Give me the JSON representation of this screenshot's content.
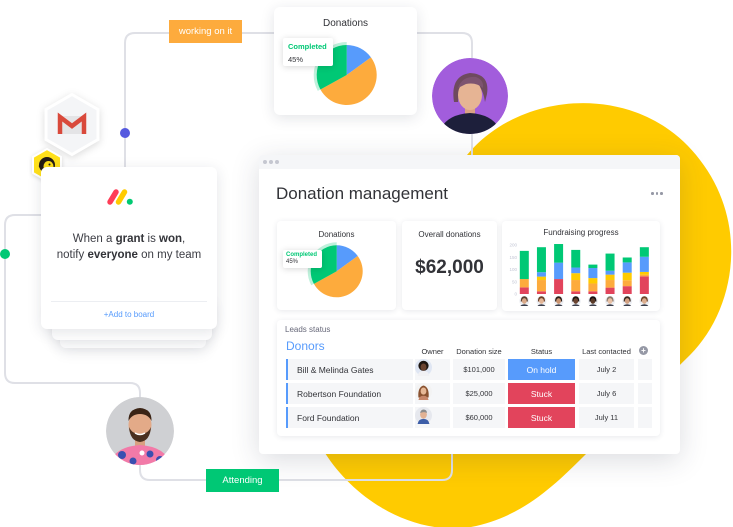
{
  "connectors": {
    "working_label": "working on it",
    "attending_label": "Attending"
  },
  "colors": {
    "brand_yellow": "#ffcb00",
    "green": "#00c875",
    "blue": "#579bfc",
    "orange": "#fdab3d",
    "red": "#e2445c",
    "purple": "#a25ddc",
    "connector_dot_blue": "#5559df"
  },
  "integrations": {
    "gmail": "gmail-icon",
    "mailchimp": "mailchimp-icon"
  },
  "automation": {
    "sentence": {
      "t1": "When a ",
      "b1": "grant",
      "t2": " is ",
      "b2": "won",
      "t3": ",",
      "t4": "notify ",
      "b3": "everyone",
      "t5": " on my team"
    },
    "add_label": "+Add to board"
  },
  "board": {
    "title": "Donation management",
    "widgets": {
      "overall": {
        "title": "Overall donations",
        "value": "$62,000"
      }
    },
    "leads": {
      "title": "Leads status",
      "group": "Donors",
      "columns": {
        "owner": "Owner",
        "donation": "Donation size",
        "status": "Status",
        "last": "Last contacted"
      },
      "rows": [
        {
          "name": "Bill & Melinda Gates",
          "donation": "$101,000",
          "status": "On hold",
          "status_color": "#579bfc",
          "last_contacted": "July 2"
        },
        {
          "name": "Robertson Foundation",
          "donation": "$25,000",
          "status": "Stuck",
          "status_color": "#e2445c",
          "last_contacted": "July 6"
        },
        {
          "name": "Ford Foundation",
          "donation": "$60,000",
          "status": "Stuck",
          "status_color": "#e2445c",
          "last_contacted": "July 11"
        }
      ]
    }
  },
  "chart_data": [
    {
      "type": "pie",
      "title": "Donations",
      "tooltip": {
        "label": "Completed",
        "value": "45%"
      },
      "slices": [
        {
          "label": "blue",
          "value": 15,
          "color": "#579bfc"
        },
        {
          "label": "orange",
          "value": 52,
          "color": "#fdab3d"
        },
        {
          "label": "Completed",
          "value": 33,
          "color": "#00c875",
          "highlight": true
        }
      ]
    },
    {
      "type": "pie",
      "title": "Donations",
      "tooltip": {
        "label": "Completed",
        "value": "45%"
      },
      "slices": [
        {
          "label": "blue",
          "value": 15,
          "color": "#579bfc"
        },
        {
          "label": "orange",
          "value": 52,
          "color": "#fdab3d"
        },
        {
          "label": "Completed",
          "value": 33,
          "color": "#00c875",
          "highlight": true
        }
      ]
    },
    {
      "type": "bar",
      "stacked": true,
      "title": "Fundraising progress",
      "xlabel": "",
      "ylabel": "",
      "y_ticks": [
        0,
        50,
        100,
        150,
        200
      ],
      "ylim": [
        0,
        200
      ],
      "grid": false,
      "legend": "none",
      "categories": [
        {
          "avatar": "owner-avatar",
          "skin": "#d9a988",
          "hair": "#5a4030"
        },
        {
          "avatar": "owner-avatar",
          "skin": "#e2b596",
          "hair": "#6b3f26"
        },
        {
          "avatar": "owner-avatar",
          "skin": "#c99370",
          "hair": "#2a1d15"
        },
        {
          "avatar": "owner-avatar",
          "skin": "#6b4430",
          "hair": "#1c1410"
        },
        {
          "avatar": "owner-avatar",
          "skin": "#5a3a28",
          "hair": "#161010"
        },
        {
          "avatar": "owner-avatar",
          "skin": "#e8c0a4",
          "hair": "#8a7a6a"
        },
        {
          "avatar": "owner-avatar",
          "skin": "#d3a283",
          "hair": "#3a2a20"
        },
        {
          "avatar": "owner-avatar",
          "skin": "#dcae8e",
          "hair": "#6e4528"
        }
      ],
      "series": [
        {
          "name": "red",
          "color": "#e2445c",
          "values": [
            27,
            11,
            61,
            11,
            11,
            26,
            32,
            72
          ]
        },
        {
          "name": "orange",
          "color": "#fdab3d",
          "values": [
            34,
            46,
            0,
            46,
            32,
            31,
            24,
            7
          ]
        },
        {
          "name": "yellow",
          "color": "#ffcb00",
          "values": [
            0,
            14,
            0,
            28,
            22,
            22,
            31,
            11
          ]
        },
        {
          "name": "blue",
          "color": "#579bfc",
          "values": [
            0,
            18,
            67,
            23,
            41,
            16,
            42,
            62
          ]
        },
        {
          "name": "green",
          "color": "#00c875",
          "values": [
            115,
            102,
            76,
            72,
            14,
            70,
            20,
            39
          ]
        }
      ]
    }
  ]
}
